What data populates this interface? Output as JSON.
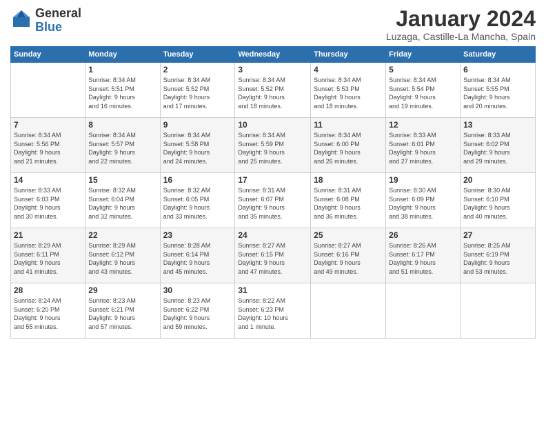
{
  "logo": {
    "general": "General",
    "blue": "Blue"
  },
  "header": {
    "title": "January 2024",
    "location": "Luzaga, Castille-La Mancha, Spain"
  },
  "weekdays": [
    "Sunday",
    "Monday",
    "Tuesday",
    "Wednesday",
    "Thursday",
    "Friday",
    "Saturday"
  ],
  "weeks": [
    [
      {
        "day": "",
        "info": ""
      },
      {
        "day": "1",
        "info": "Sunrise: 8:34 AM\nSunset: 5:51 PM\nDaylight: 9 hours\nand 16 minutes."
      },
      {
        "day": "2",
        "info": "Sunrise: 8:34 AM\nSunset: 5:52 PM\nDaylight: 9 hours\nand 17 minutes."
      },
      {
        "day": "3",
        "info": "Sunrise: 8:34 AM\nSunset: 5:52 PM\nDaylight: 9 hours\nand 18 minutes."
      },
      {
        "day": "4",
        "info": "Sunrise: 8:34 AM\nSunset: 5:53 PM\nDaylight: 9 hours\nand 18 minutes."
      },
      {
        "day": "5",
        "info": "Sunrise: 8:34 AM\nSunset: 5:54 PM\nDaylight: 9 hours\nand 19 minutes."
      },
      {
        "day": "6",
        "info": "Sunrise: 8:34 AM\nSunset: 5:55 PM\nDaylight: 9 hours\nand 20 minutes."
      }
    ],
    [
      {
        "day": "7",
        "info": "Sunrise: 8:34 AM\nSunset: 5:56 PM\nDaylight: 9 hours\nand 21 minutes."
      },
      {
        "day": "8",
        "info": "Sunrise: 8:34 AM\nSunset: 5:57 PM\nDaylight: 9 hours\nand 22 minutes."
      },
      {
        "day": "9",
        "info": "Sunrise: 8:34 AM\nSunset: 5:58 PM\nDaylight: 9 hours\nand 24 minutes."
      },
      {
        "day": "10",
        "info": "Sunrise: 8:34 AM\nSunset: 5:59 PM\nDaylight: 9 hours\nand 25 minutes."
      },
      {
        "day": "11",
        "info": "Sunrise: 8:34 AM\nSunset: 6:00 PM\nDaylight: 9 hours\nand 26 minutes."
      },
      {
        "day": "12",
        "info": "Sunrise: 8:33 AM\nSunset: 6:01 PM\nDaylight: 9 hours\nand 27 minutes."
      },
      {
        "day": "13",
        "info": "Sunrise: 8:33 AM\nSunset: 6:02 PM\nDaylight: 9 hours\nand 29 minutes."
      }
    ],
    [
      {
        "day": "14",
        "info": "Sunrise: 8:33 AM\nSunset: 6:03 PM\nDaylight: 9 hours\nand 30 minutes."
      },
      {
        "day": "15",
        "info": "Sunrise: 8:32 AM\nSunset: 6:04 PM\nDaylight: 9 hours\nand 32 minutes."
      },
      {
        "day": "16",
        "info": "Sunrise: 8:32 AM\nSunset: 6:05 PM\nDaylight: 9 hours\nand 33 minutes."
      },
      {
        "day": "17",
        "info": "Sunrise: 8:31 AM\nSunset: 6:07 PM\nDaylight: 9 hours\nand 35 minutes."
      },
      {
        "day": "18",
        "info": "Sunrise: 8:31 AM\nSunset: 6:08 PM\nDaylight: 9 hours\nand 36 minutes."
      },
      {
        "day": "19",
        "info": "Sunrise: 8:30 AM\nSunset: 6:09 PM\nDaylight: 9 hours\nand 38 minutes."
      },
      {
        "day": "20",
        "info": "Sunrise: 8:30 AM\nSunset: 6:10 PM\nDaylight: 9 hours\nand 40 minutes."
      }
    ],
    [
      {
        "day": "21",
        "info": "Sunrise: 8:29 AM\nSunset: 6:11 PM\nDaylight: 9 hours\nand 41 minutes."
      },
      {
        "day": "22",
        "info": "Sunrise: 8:29 AM\nSunset: 6:12 PM\nDaylight: 9 hours\nand 43 minutes."
      },
      {
        "day": "23",
        "info": "Sunrise: 8:28 AM\nSunset: 6:14 PM\nDaylight: 9 hours\nand 45 minutes."
      },
      {
        "day": "24",
        "info": "Sunrise: 8:27 AM\nSunset: 6:15 PM\nDaylight: 9 hours\nand 47 minutes."
      },
      {
        "day": "25",
        "info": "Sunrise: 8:27 AM\nSunset: 6:16 PM\nDaylight: 9 hours\nand 49 minutes."
      },
      {
        "day": "26",
        "info": "Sunrise: 8:26 AM\nSunset: 6:17 PM\nDaylight: 9 hours\nand 51 minutes."
      },
      {
        "day": "27",
        "info": "Sunrise: 8:25 AM\nSunset: 6:19 PM\nDaylight: 9 hours\nand 53 minutes."
      }
    ],
    [
      {
        "day": "28",
        "info": "Sunrise: 8:24 AM\nSunset: 6:20 PM\nDaylight: 9 hours\nand 55 minutes."
      },
      {
        "day": "29",
        "info": "Sunrise: 8:23 AM\nSunset: 6:21 PM\nDaylight: 9 hours\nand 57 minutes."
      },
      {
        "day": "30",
        "info": "Sunrise: 8:23 AM\nSunset: 6:22 PM\nDaylight: 9 hours\nand 59 minutes."
      },
      {
        "day": "31",
        "info": "Sunrise: 8:22 AM\nSunset: 6:23 PM\nDaylight: 10 hours\nand 1 minute."
      },
      {
        "day": "",
        "info": ""
      },
      {
        "day": "",
        "info": ""
      },
      {
        "day": "",
        "info": ""
      }
    ]
  ]
}
